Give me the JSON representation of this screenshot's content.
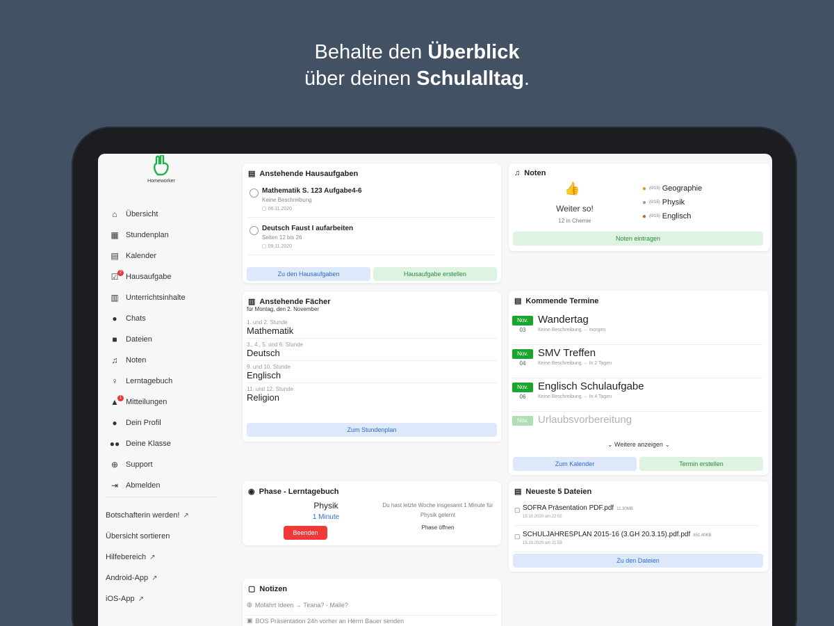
{
  "headline": {
    "line1_pre": "Behalte den ",
    "line1_bold": "Überblick",
    "line2_pre": "über deinen ",
    "line2_bold": "Schulalltag",
    "line2_post": "."
  },
  "app": {
    "name": "Homeworker"
  },
  "sidebar": {
    "items": [
      {
        "label": "Übersicht",
        "icon": "home-icon"
      },
      {
        "label": "Stundenplan",
        "icon": "table-icon"
      },
      {
        "label": "Kalender",
        "icon": "calendar-icon"
      },
      {
        "label": "Hausaufgabe",
        "icon": "check-icon",
        "badge": "2"
      },
      {
        "label": "Unterrichtsinhalte",
        "icon": "book-icon"
      },
      {
        "label": "Chats",
        "icon": "chat-icon"
      },
      {
        "label": "Dateien",
        "icon": "folder-icon"
      },
      {
        "label": "Noten",
        "icon": "music-icon"
      },
      {
        "label": "Lerntagebuch",
        "icon": "bulb-icon"
      },
      {
        "label": "Mitteilungen",
        "icon": "bell-icon",
        "badge": "1"
      },
      {
        "label": "Dein Profil",
        "icon": "user-icon"
      },
      {
        "label": "Deine Klasse",
        "icon": "users-icon"
      },
      {
        "label": "Support",
        "icon": "support-icon"
      },
      {
        "label": "Abmelden",
        "icon": "logout-icon"
      }
    ],
    "links": [
      {
        "label": "Botschafterin werden!",
        "external": true
      },
      {
        "label": "Übersicht sortieren",
        "external": false
      },
      {
        "label": "Hilfebereich",
        "external": true
      },
      {
        "label": "Android-App",
        "external": true
      },
      {
        "label": "iOS-App",
        "external": true
      }
    ]
  },
  "homework": {
    "title": "Anstehende Hausaufgaben",
    "items": [
      {
        "title": "Mathematik S. 123 Aufgabe4-6",
        "desc": "Keine Beschreibung",
        "date": "06.11.2020"
      },
      {
        "title": "Deutsch Faust I aufarbeiten",
        "desc": "Seiten 12 bis 26",
        "date": "09.11.2020"
      }
    ],
    "btn_list": "Zu den Hausaufgaben",
    "btn_create": "Hausaufgabe erstellen"
  },
  "subjects": {
    "title": "Anstehende Fächer",
    "subtitle": "für Montag, den 2. November",
    "items": [
      {
        "hours": "1. und 2. Stunde",
        "name": "Mathematik"
      },
      {
        "hours": "3., 4., 5. und 6. Stunde",
        "name": "Deutsch"
      },
      {
        "hours": "9. und 10. Stunde",
        "name": "Englisch"
      },
      {
        "hours": "11. und 12. Stunde",
        "name": "Religion"
      }
    ],
    "btn": "Zum Stundenplan"
  },
  "phase": {
    "title": "Phase - Lerntagebuch",
    "subject": "Physik",
    "duration": "1 Minute",
    "btn_end": "Beenden",
    "info": "Du hast letzte Woche insgesamt 1 Minute für Physik gelernt",
    "btn_open": "Phase öffnen"
  },
  "notes": {
    "title": "Notizen",
    "items": [
      {
        "icon": "globe-icon",
        "text": "Mofahrt Ideen → Tirana? - Malle?"
      },
      {
        "icon": "lock-icon",
        "text": "BOS Präsentation 24h vorher an Herrn Bauer senden"
      }
    ]
  },
  "grades": {
    "title": "Noten",
    "thumb_text": "Weiter so!",
    "thumb_sub": "12 in Chemie",
    "rows": [
      {
        "medal": "gold-medal-icon",
        "score": "(0/15)",
        "subject": "Geographie"
      },
      {
        "medal": "silver-medal-icon",
        "score": "(0/15)",
        "subject": "Physik"
      },
      {
        "medal": "bronze-medal-icon",
        "score": "(0/15)",
        "subject": "Englisch"
      }
    ],
    "btn": "Noten eintragen"
  },
  "events": {
    "title": "Kommende Termine",
    "items": [
      {
        "month": "Nov.",
        "day": "03",
        "title": "Wandertag",
        "desc": "Keine Beschreibung → morgen"
      },
      {
        "month": "Nov.",
        "day": "04",
        "title": "SMV Treffen",
        "desc": "Keine Beschreibung → In 2 Tagen"
      },
      {
        "month": "Nov.",
        "day": "06",
        "title": "Englisch Schulaufgabe",
        "desc": "Keine Beschreibung → In 4 Tagen"
      },
      {
        "month": "Nov.",
        "day": "",
        "title": "Urlaubsvorbereitung",
        "desc": ""
      }
    ],
    "more": "Weitere anzeigen",
    "btn_calendar": "Zum Kalender",
    "btn_create": "Termin erstellen"
  },
  "files": {
    "title": "Neueste 5 Dateien",
    "items": [
      {
        "name": "SOFRA Präsentation PDF.pdf",
        "size": "11.30MB",
        "date": "15.10.2020 um 22:02"
      },
      {
        "name": "SCHULJAHRESPLAN 2015-16 (3.GH 20.3.15).pdf.pdf",
        "size": "851.40KB",
        "date": "15.10.2020 um 21:59"
      }
    ],
    "btn": "Zu den Dateien"
  },
  "colors": {
    "background": "#435165",
    "accent_blue": "#2c6bd7",
    "accent_green": "#19a52e",
    "danger": "#f03a3a"
  }
}
